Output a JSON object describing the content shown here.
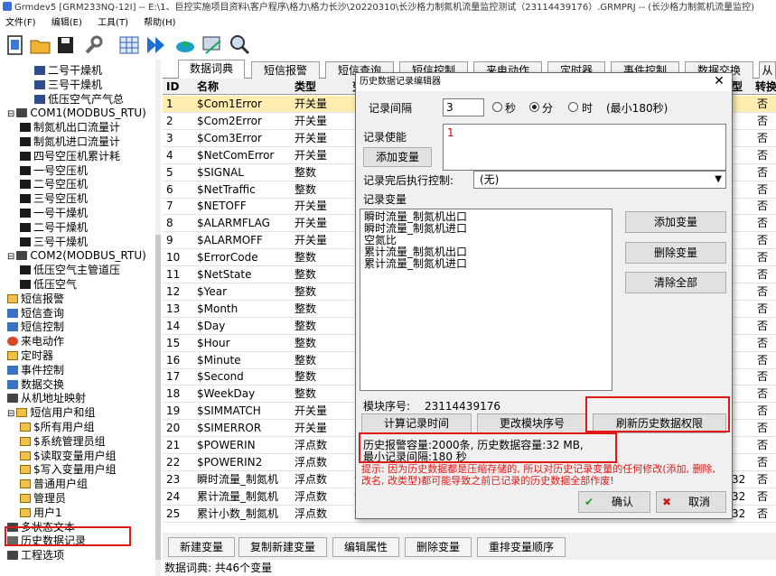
{
  "window": {
    "title": "Grmdev5 [GRM233NQ-12I] -- E:\\1、巨控实施项目资料\\客户程序\\格力\\格力长沙\\20220310\\长沙格力制氮机流量监控测试（23114439176）.GRMPRJ -- (长沙格力制氮机流量监控)"
  },
  "menu": [
    "文件(F)",
    "编辑(E)",
    "工具(T)",
    "帮助(H)"
  ],
  "toolbar": {
    "icons": [
      "new-file-icon",
      "open-folder-icon",
      "save-icon",
      "wrench-icon",
      "grid-icon",
      "download-icon",
      "upload-cloud-icon",
      "monitor-icon",
      "search-icon"
    ]
  },
  "tree": {
    "items": [
      {
        "label": "二号干燥机",
        "icon": "var"
      },
      {
        "label": "三号干燥机",
        "icon": "var"
      },
      {
        "label": "低压空气产气总",
        "icon": "var"
      },
      {
        "label": "COM1(MODBUS_RTU)",
        "icon": "dev",
        "expander": "⊟"
      },
      {
        "label": "制氮机出口流量计",
        "icon": "grp"
      },
      {
        "label": "制氮机进口流量计",
        "icon": "grp"
      },
      {
        "label": "四号空压机累计耗",
        "icon": "grp"
      },
      {
        "label": "一号空压机",
        "icon": "grp"
      },
      {
        "label": "二号空压机",
        "icon": "grp"
      },
      {
        "label": "三号空压机",
        "icon": "grp"
      },
      {
        "label": "一号干燥机",
        "icon": "grp"
      },
      {
        "label": "二号干燥机",
        "icon": "grp"
      },
      {
        "label": "三号干燥机",
        "icon": "grp"
      },
      {
        "label": "COM2(MODBUS_RTU)",
        "icon": "dev",
        "expander": "⊟"
      },
      {
        "label": "低压空气主管道压",
        "icon": "grp"
      },
      {
        "label": "低压空气",
        "icon": "grp"
      },
      {
        "label": "短信报警",
        "icon": "user"
      },
      {
        "label": "短信查询",
        "icon": "blue"
      },
      {
        "label": "短信控制",
        "icon": "blue"
      },
      {
        "label": "来电动作",
        "icon": "red"
      },
      {
        "label": "定时器",
        "icon": "user"
      },
      {
        "label": "事件控制",
        "icon": "blue"
      },
      {
        "label": "数据交换",
        "icon": "blue"
      },
      {
        "label": "从机地址映射",
        "icon": "dev"
      },
      {
        "label": "短信用户和组",
        "icon": "user",
        "expander": "⊟"
      },
      {
        "label": "$所有用户组",
        "icon": "user"
      },
      {
        "label": "$系统管理员组",
        "icon": "user"
      },
      {
        "label": "$读取变量用户组",
        "icon": "user"
      },
      {
        "label": "$写入变量用户组",
        "icon": "user"
      },
      {
        "label": "普通用户组",
        "icon": "user"
      },
      {
        "label": "管理员",
        "icon": "user"
      },
      {
        "label": "用户1",
        "icon": "user"
      },
      {
        "label": "多状态文本",
        "icon": "dev"
      },
      {
        "label": "历史数据记录",
        "icon": "hist"
      },
      {
        "label": "工程选项",
        "icon": "dev"
      }
    ]
  },
  "tabs": [
    "数据词典",
    "短信报警",
    "短信查询",
    "短信控制",
    "来电动作",
    "定时器",
    "事件控制",
    "数据交换",
    "从"
  ],
  "table": {
    "headers": [
      "ID",
      "名称",
      "类型",
      "变",
      "型",
      "转换"
    ],
    "rows": [
      {
        "id": "1",
        "name": "$Com1Error",
        "type": "开关量",
        "conv": "否"
      },
      {
        "id": "2",
        "name": "$Com2Error",
        "type": "开关量",
        "conv": "否"
      },
      {
        "id": "3",
        "name": "$Com3Error",
        "type": "开关量",
        "conv": "否"
      },
      {
        "id": "4",
        "name": "$NetComError",
        "type": "开关量",
        "conv": "否"
      },
      {
        "id": "5",
        "name": "$SIGNAL",
        "type": "整数",
        "conv": "否"
      },
      {
        "id": "6",
        "name": "$NetTraffic",
        "type": "整数",
        "conv": "否"
      },
      {
        "id": "7",
        "name": "$NETOFF",
        "type": "开关量",
        "conv": "否"
      },
      {
        "id": "8",
        "name": "$ALARMFLAG",
        "type": "开关量",
        "conv": "否"
      },
      {
        "id": "9",
        "name": "$ALARMOFF",
        "type": "开关量",
        "conv": "否"
      },
      {
        "id": "10",
        "name": "$ErrorCode",
        "type": "整数",
        "conv": "否"
      },
      {
        "id": "11",
        "name": "$NetState",
        "type": "整数",
        "conv": "否"
      },
      {
        "id": "12",
        "name": "$Year",
        "type": "整数",
        "conv": "否"
      },
      {
        "id": "13",
        "name": "$Month",
        "type": "整数",
        "conv": "否"
      },
      {
        "id": "14",
        "name": "$Day",
        "type": "整数",
        "conv": "否"
      },
      {
        "id": "15",
        "name": "$Hour",
        "type": "整数",
        "conv": "否"
      },
      {
        "id": "16",
        "name": "$Minute",
        "type": "整数",
        "conv": "否"
      },
      {
        "id": "17",
        "name": "$Second",
        "type": "整数",
        "conv": "否"
      },
      {
        "id": "18",
        "name": "$WeekDay",
        "type": "整数",
        "conv": "否"
      },
      {
        "id": "19",
        "name": "$SIMMATCH",
        "type": "开关量",
        "conv": "否"
      },
      {
        "id": "20",
        "name": "$SIMERROR",
        "type": "开关量",
        "conv": "否"
      },
      {
        "id": "21",
        "name": "$POWERIN",
        "type": "浮点数",
        "conv": "否"
      },
      {
        "id": "22",
        "name": "$POWERIN2",
        "type": "浮点数",
        "conv": "否"
      },
      {
        "id": "23",
        "name": "瞬时流量_制氮机",
        "type": "浮点数",
        "var": "浮",
        "model": "32",
        "conv": "否"
      },
      {
        "id": "24",
        "name": "累计流量_制氮机",
        "type": "浮点数",
        "var": "浮",
        "model": "32",
        "conv": "否"
      },
      {
        "id": "25",
        "name": "累计小数_制氮机",
        "type": "浮点数",
        "var": "浮",
        "model": "32",
        "conv": "否"
      }
    ]
  },
  "bottom_buttons": [
    "新建变量",
    "复制新建变量",
    "编辑属性",
    "删除变量",
    "重排变量顺序"
  ],
  "status": "数据词典: 共46个变量",
  "dialog": {
    "title": "历史数据记录编辑器",
    "interval_label": "记录间隔",
    "interval_value": "3",
    "unit_sec": "秒",
    "unit_min": "分",
    "unit_hour": "时",
    "unit_selected": "分",
    "min_note": "(最小180秒)",
    "enable_label": "记录使能",
    "enable_value": "1",
    "add_var_btn": "添加变量",
    "after_label": "记录完后执行控制:",
    "after_value": "(无)",
    "vars_label": "记录变量",
    "vars": [
      "瞬时流量_制氮机出口",
      "瞬时流量_制氮机进口",
      "空氮比",
      "累计流量_制氮机出口",
      "累计流量_制氮机进口"
    ],
    "add_btn": "添加变量",
    "delete_btn": "删除变量",
    "clear_btn": "清除全部",
    "serial_label": "模块序号:",
    "serial_value": "23114439176",
    "calc_btn": "计算记录时间",
    "change_serial_btn": "更改模块序号",
    "refresh_btn": "刷新历史数据权限",
    "capacity": "历史报警容量:2000条, 历史数据容量:32 MB,",
    "min_interval": "最小记录间隔:180 秒",
    "warning": "提示: 因为历史数据都是压缩存储的, 所以对历史记录变量的任何修改(添加, 删除, 改名, 改类型)都可能导致之前已记录的历史数据全部作废!",
    "ok": "确认",
    "cancel": "取消"
  },
  "colors": {
    "highlight": "#e01818",
    "selected_row": "#ffeeb0",
    "warning_text": "#e01818"
  }
}
